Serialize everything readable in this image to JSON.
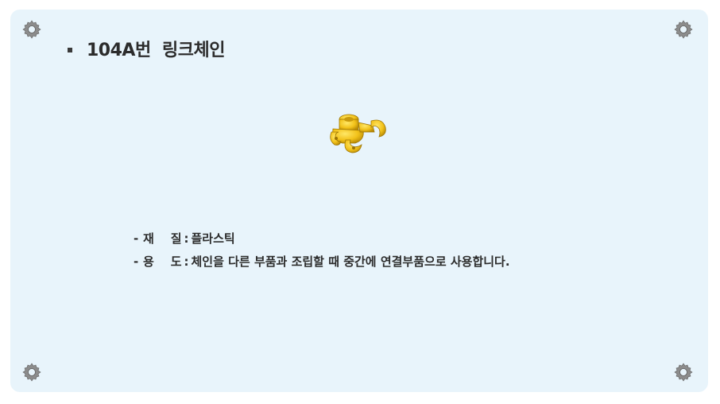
{
  "slide": {
    "title": "104A번  링크체인",
    "part_image_icon": "yellow-link-chain-part",
    "specs": [
      {
        "dash": "-",
        "key": "재    질",
        "sep": ":",
        "value": "플라스틱"
      },
      {
        "dash": "-",
        "key": "용    도",
        "sep": ":",
        "value": "체인을 다른 부품과 조립할 때 중간에 연결부품으로 사용합니다."
      }
    ]
  },
  "decorations": {
    "corner_icon": "gear-icon",
    "background_color": "#e8f4fb",
    "part_color": "#f2c21a"
  }
}
